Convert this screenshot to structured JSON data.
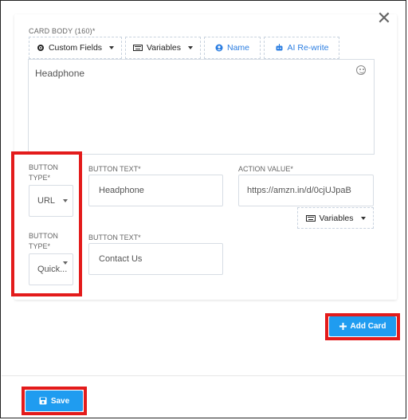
{
  "card_body": {
    "label": "CARD BODY (160)*",
    "value": "Headphone"
  },
  "toolbar": {
    "custom_fields": "Custom Fields",
    "variables": "Variables",
    "name": "Name",
    "ai_rewrite": "AI Re-write"
  },
  "row1": {
    "button_type_label": "BUTTON TYPE*",
    "button_type_value": "URL",
    "button_text_label": "BUTTON TEXT*",
    "button_text_value": "Headphone",
    "action_value_label": "ACTION VALUE*",
    "action_value_value": "https://amzn.in/d/0cjUJpaB",
    "variables": "Variables"
  },
  "row2": {
    "button_type_label": "BUTTON TYPE*",
    "button_type_value": "Quick...",
    "button_text_label": "BUTTON TEXT*",
    "button_text_value": "Contact Us"
  },
  "actions": {
    "add_card": "Add Card",
    "save": "Save"
  },
  "colors": {
    "accent": "#1f9cf0",
    "highlight": "#e31b1b"
  }
}
